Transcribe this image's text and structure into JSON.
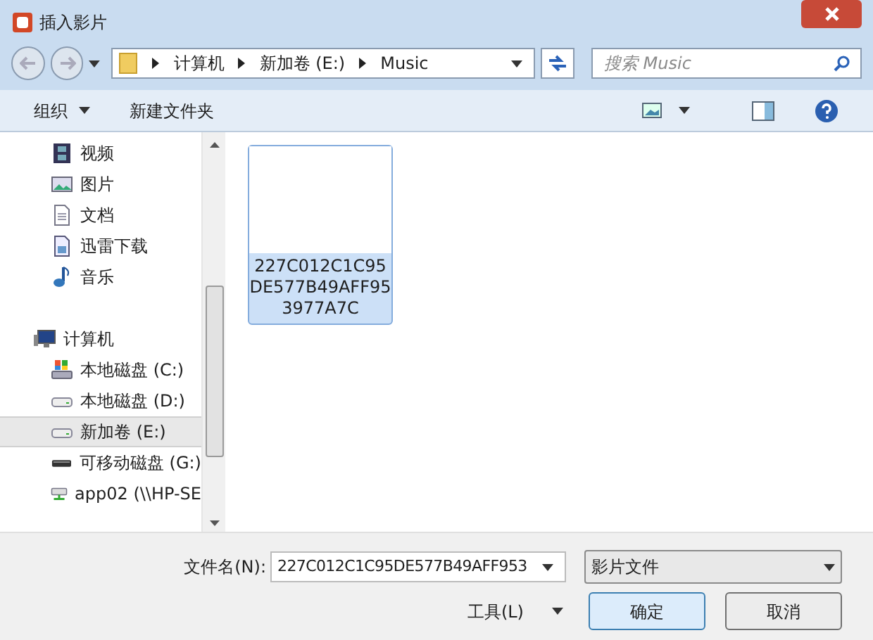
{
  "window": {
    "title": "插入影片"
  },
  "address": {
    "crumbs": [
      "计算机",
      "新加卷 (E:)",
      "Music"
    ]
  },
  "search": {
    "placeholder": "搜索 Music"
  },
  "toolbar": {
    "organize": "组织",
    "new_folder": "新建文件夹"
  },
  "sidebar": {
    "items": [
      {
        "label": "视频",
        "kind": "video",
        "selected": false
      },
      {
        "label": "图片",
        "kind": "image",
        "selected": false
      },
      {
        "label": "文档",
        "kind": "document",
        "selected": false
      },
      {
        "label": "迅雷下载",
        "kind": "download",
        "selected": false
      },
      {
        "label": "音乐",
        "kind": "music",
        "selected": false
      },
      {
        "label": "计算机",
        "kind": "computer",
        "selected": false
      },
      {
        "label": "本地磁盘 (C:)",
        "kind": "system-drive",
        "selected": false
      },
      {
        "label": "本地磁盘 (D:)",
        "kind": "drive",
        "selected": false
      },
      {
        "label": "新加卷 (E:)",
        "kind": "drive",
        "selected": true
      },
      {
        "label": "可移动磁盘 (G:)",
        "kind": "removable",
        "selected": false
      },
      {
        "label": "app02 (\\\\HP-SE",
        "kind": "network",
        "selected": false
      }
    ]
  },
  "files": [
    {
      "lines": [
        "227C012C1C95",
        "DE577B49AFF95",
        "3977A7C"
      ],
      "selected": true
    }
  ],
  "footer": {
    "filename_label": "文件名(N):",
    "filename": "227C012C1C95DE577B49AFF953",
    "filetype": "影片文件",
    "tools": "工具(L)",
    "ok": "确定",
    "cancel": "取消"
  }
}
